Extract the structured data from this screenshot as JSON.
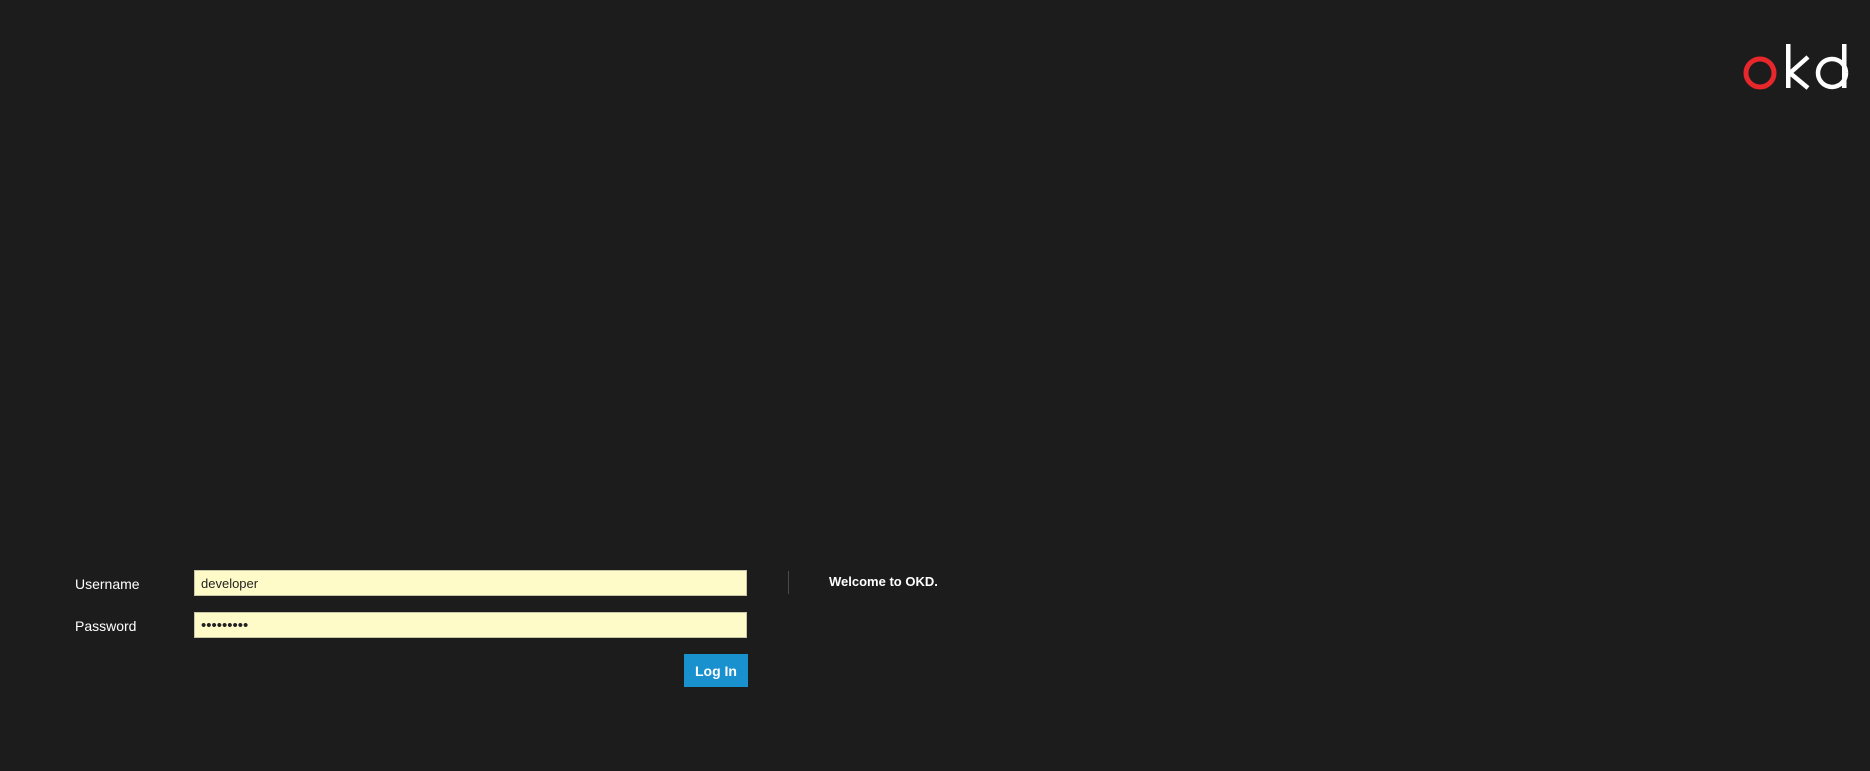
{
  "brand": {
    "logo_text": "okd",
    "logo_accent_color": "#e8272c",
    "logo_text_color": "#ffffff"
  },
  "login": {
    "username_label": "Username",
    "username_value": "developer",
    "password_label": "Password",
    "password_value": "•••••••••",
    "submit_label": "Log In"
  },
  "welcome": {
    "message": "Welcome to OKD."
  },
  "colors": {
    "background": "#1c1c1c",
    "input_background": "#fffbc8",
    "button_background": "#1a91cf"
  }
}
